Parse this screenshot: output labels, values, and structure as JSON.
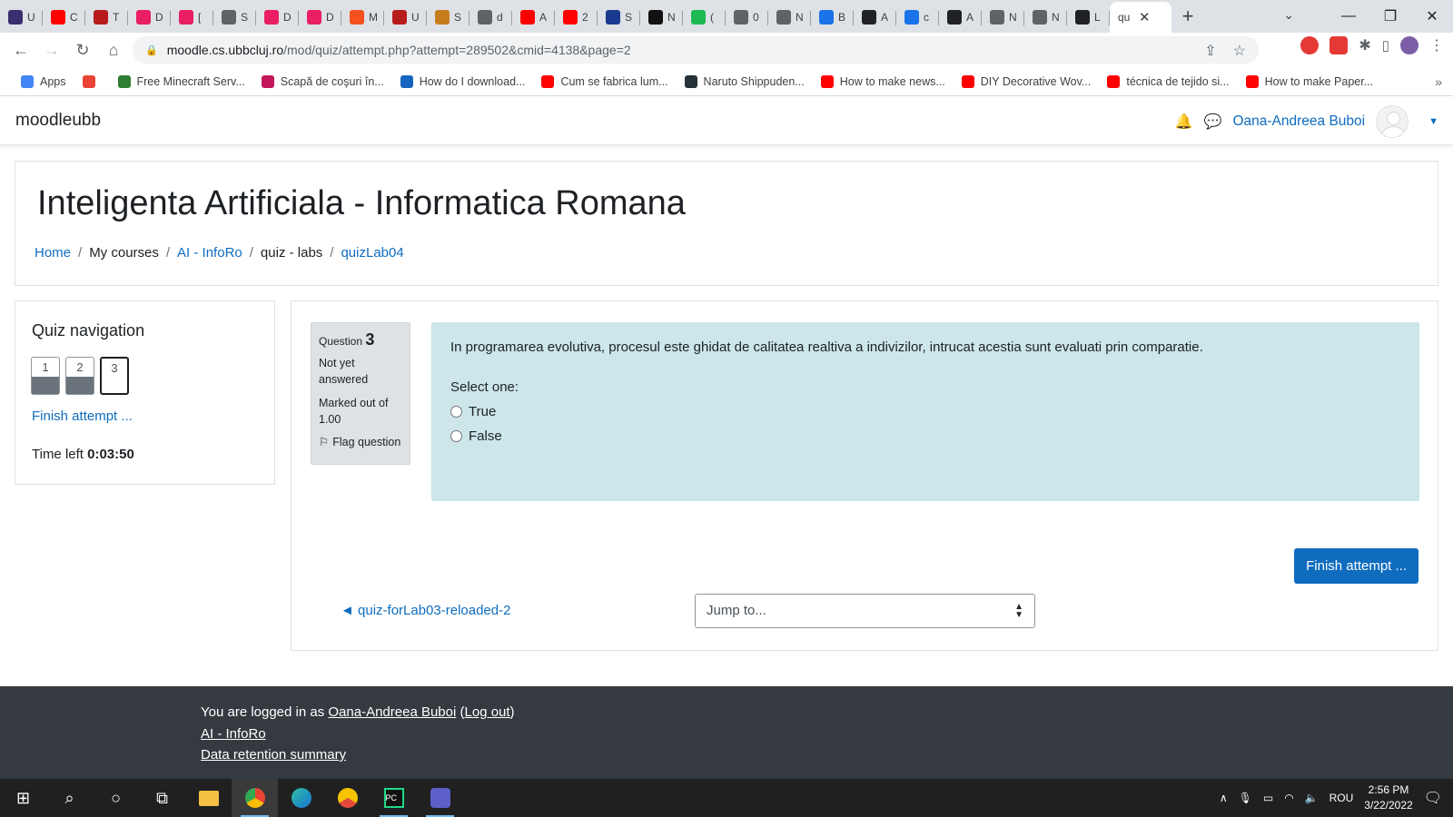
{
  "browser": {
    "tabs": [
      {
        "title": "U",
        "color": "#3b2e6e"
      },
      {
        "title": "C",
        "color": "#ff0000"
      },
      {
        "title": "T",
        "color": "#b71c1c"
      },
      {
        "title": "D",
        "color": "#e91e63"
      },
      {
        "title": "[",
        "color": "#e91e63"
      },
      {
        "title": "S",
        "color": "#5f6368"
      },
      {
        "title": "D",
        "color": "#e91e63"
      },
      {
        "title": "D",
        "color": "#e91e63"
      },
      {
        "title": "M",
        "color": "#f4511e"
      },
      {
        "title": "U",
        "color": "#b71c1c"
      },
      {
        "title": "S",
        "color": "#c67c1c"
      },
      {
        "title": "d",
        "color": "#5f6368"
      },
      {
        "title": "A",
        "color": "#ff0000"
      },
      {
        "title": "2",
        "color": "#ff0000"
      },
      {
        "title": "S",
        "color": "#1a3a8f"
      },
      {
        "title": "N",
        "color": "#111111"
      },
      {
        "title": "(",
        "color": "#1db954"
      },
      {
        "title": "0",
        "color": "#5f6368"
      },
      {
        "title": "N",
        "color": "#5f6368"
      },
      {
        "title": "B",
        "color": "#1a73e8"
      },
      {
        "title": "A",
        "color": "#202124"
      },
      {
        "title": "c",
        "color": "#1a73e8"
      },
      {
        "title": "A",
        "color": "#202124"
      },
      {
        "title": "N",
        "color": "#5f6368"
      },
      {
        "title": "N",
        "color": "#5f6368"
      },
      {
        "title": "L",
        "color": "#202124"
      }
    ],
    "active_tab": {
      "title": "qu",
      "close": "✕"
    },
    "new_tab": "+",
    "url_host": "moodle.cs.ubbcluj.ro",
    "url_path": "/mod/quiz/attempt.php?attempt=289502&cmid=4138&page=2",
    "bookmarks": [
      {
        "label": "Apps",
        "color": "#4285f4"
      },
      {
        "label": "",
        "color": "#ea4335"
      },
      {
        "label": "Free Minecraft Serv...",
        "color": "#2e7d32"
      },
      {
        "label": "Scapă de coşuri în...",
        "color": "#c2185b"
      },
      {
        "label": "How do I download...",
        "color": "#1565c0"
      },
      {
        "label": "Cum se fabrica lum...",
        "color": "#ff0000"
      },
      {
        "label": "Naruto Shippuden...",
        "color": "#263238"
      },
      {
        "label": "How to make news...",
        "color": "#ff0000"
      },
      {
        "label": "DIY Decorative Wov...",
        "color": "#ff0000"
      },
      {
        "label": "técnica de tejido si...",
        "color": "#ff0000"
      },
      {
        "label": "How to make Paper...",
        "color": "#ff0000"
      }
    ]
  },
  "moodle": {
    "brand": "moodleubb",
    "user_name": "Oana-Andreea Buboi",
    "course_title": "Inteligenta Artificiala - Informatica Romana",
    "breadcrumb": {
      "home": "Home",
      "my_courses": "My courses",
      "course": "AI - InfoRo",
      "section": "quiz - labs",
      "quiz": "quizLab04"
    },
    "quiz_nav": {
      "title": "Quiz navigation",
      "buttons": [
        "1",
        "2",
        "3"
      ],
      "finish_link": "Finish attempt ...",
      "time_label": "Time left",
      "time_value": "0:03:50"
    },
    "question": {
      "label": "Question",
      "number": "3",
      "state": "Not yet answered",
      "grade": "Marked out of 1.00",
      "flag": "Flag question",
      "text": "In programarea evolutiva, procesul este ghidat de calitatea realtiva a indivizilor, intrucat acestia sunt evaluati prin comparatie.",
      "prompt": "Select one:",
      "options": [
        "True",
        "False"
      ]
    },
    "finish_button": "Finish attempt ...",
    "prev_link": "◄ quiz-forLab03-reloaded-2",
    "jump_select": "Jump to...",
    "footer": {
      "logged_in_prefix": "You are logged in as ",
      "user": "Oana-Andreea Buboi",
      "logout": "Log out",
      "course_link": "AI - InfoRo",
      "data_retention": "Data retention summary"
    }
  },
  "taskbar": {
    "language": "ROU",
    "time": "2:56 PM",
    "date": "3/22/2022"
  }
}
